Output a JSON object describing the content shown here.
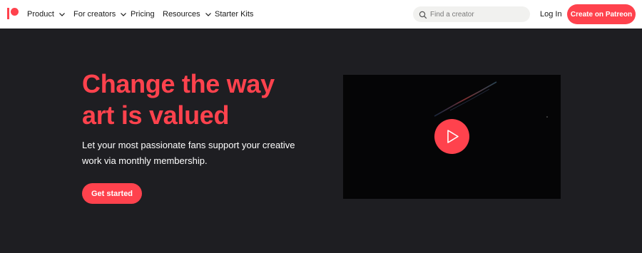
{
  "nav": {
    "logo_icon": "patreon-logo-icon",
    "items": [
      {
        "label": "Product",
        "has_dropdown": true
      },
      {
        "label": "For creators",
        "has_dropdown": true
      },
      {
        "label": "Pricing",
        "has_dropdown": false
      },
      {
        "label": "Resources",
        "has_dropdown": true
      },
      {
        "label": "Starter Kits",
        "has_dropdown": false
      }
    ],
    "search": {
      "placeholder": "Find a creator",
      "value": "",
      "icon": "search-icon"
    },
    "login_label": "Log In",
    "cta_label": "Create on Patreon"
  },
  "hero": {
    "headline_line1": "Change the way",
    "headline_line2": "art is valued",
    "subtext_line1": "Let your most passionate fans support your creative",
    "subtext_line2": "work via monthly membership.",
    "cta_label": "Get started",
    "video": {
      "play_icon": "play-icon"
    }
  },
  "colors": {
    "brand": "#ff424d",
    "hero_bg": "#1e1e22",
    "nav_bg": "#ffffff",
    "search_bg": "#f1f1ef"
  }
}
